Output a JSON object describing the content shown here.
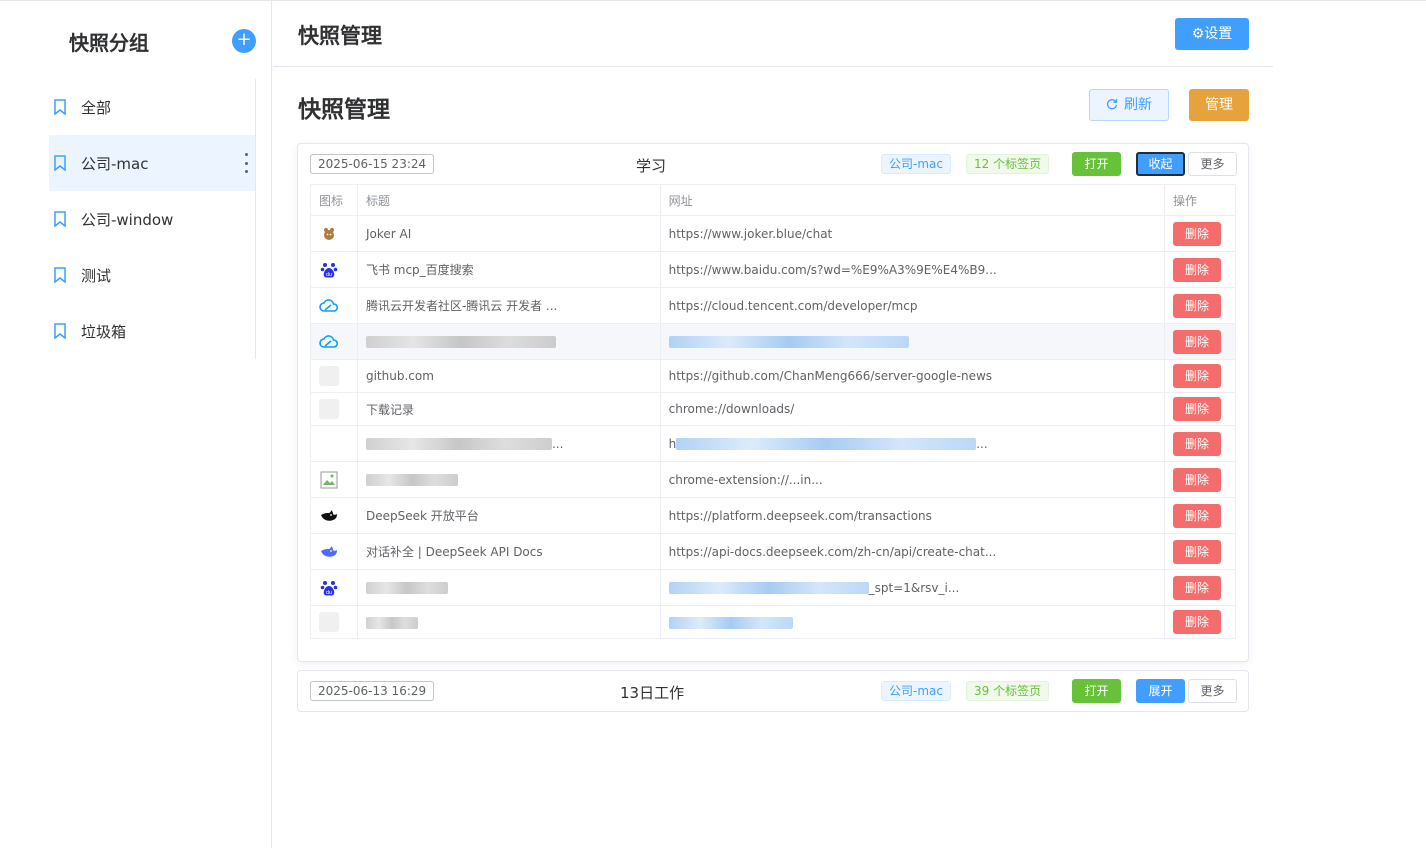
{
  "sidebar": {
    "title": "快照分组",
    "add_label": "+",
    "groups": [
      {
        "label": "全部"
      },
      {
        "label": "公司-mac"
      },
      {
        "label": "公司-window"
      },
      {
        "label": "测试"
      },
      {
        "label": "垃圾箱"
      }
    ],
    "active_group": "公司-mac"
  },
  "header": {
    "title": "快照管理",
    "settings_label": "⚙设置"
  },
  "main": {
    "title": "快照管理",
    "refresh_label": "刷新",
    "manage_label": "管理"
  },
  "snapshots": [
    {
      "date": "2025-06-15 23:24",
      "name": "学习",
      "group": "公司-mac",
      "count": "12 个标签页",
      "open_label": "打开",
      "toggle_label": "收起",
      "more_label": "更多",
      "columns": [
        "图标",
        "标题",
        "网址",
        "操作"
      ],
      "delete_label": "删除",
      "rows": [
        {
          "icon": "joker-icon",
          "title": "Joker AI",
          "url": "https://www.joker.blue/chat"
        },
        {
          "icon": "baidu-icon",
          "title": "飞书 mcp_百度搜索",
          "url": "https://www.baidu.com/s?wd=%E9%A3%9E%E4%B9..."
        },
        {
          "icon": "tencent-cloud-icon",
          "title": "腾讯云开发者社区-腾讯云 开发者 ...",
          "url": "https://cloud.tencent.com/developer/mcp"
        },
        {
          "icon": "tencent-cloud-icon",
          "title": "",
          "url": ""
        },
        {
          "icon": "blank-icon",
          "title": "github.com",
          "url": "https://github.com/ChanMeng666/server-google-news"
        },
        {
          "icon": "blank-icon",
          "title": "下载记录",
          "url": "chrome://downloads/"
        },
        {
          "icon": "none",
          "title": "...",
          "url": "...",
          "url_prefix": "h"
        },
        {
          "icon": "broken-image-icon",
          "title": "",
          "url": "chrome-extension://...in..."
        },
        {
          "icon": "deepseek-icon",
          "title": "DeepSeek 开放平台",
          "url": "https://platform.deepseek.com/transactions"
        },
        {
          "icon": "deepseek-icon",
          "title": "对话补全 | DeepSeek API Docs",
          "url": "https://api-docs.deepseek.com/zh-cn/api/create-chat..."
        },
        {
          "icon": "baidu-icon",
          "title": "",
          "url": "_spt=1&rsv_i..."
        },
        {
          "icon": "blank-icon",
          "title": "",
          "url": ""
        }
      ]
    },
    {
      "date": "2025-06-13 16:29",
      "name": "13日工作",
      "group": "公司-mac",
      "count": "39 个标签页",
      "open_label": "打开",
      "toggle_label": "展开",
      "more_label": "更多"
    }
  ],
  "colors": {
    "primary": "#409eff",
    "success": "#67c23a",
    "warning": "#e6a23c",
    "danger": "#f56c6c"
  }
}
